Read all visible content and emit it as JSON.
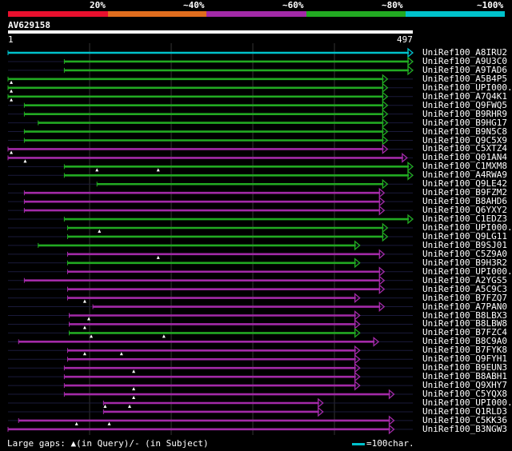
{
  "scale": {
    "labels": [
      "20%",
      "~40%",
      "~60%",
      "~80%",
      "~100%"
    ],
    "colors": [
      "#e8102e",
      "#e06d1e",
      "#a32aa8",
      "#22aa22",
      "#00c2cc"
    ]
  },
  "query": {
    "name": "AV629158",
    "start": "1",
    "end": "497",
    "length": 497
  },
  "hits": [
    {
      "name": "UniRef100_A8IRU2",
      "color": "#00c2cc",
      "segs": [
        [
          1,
          497
        ]
      ],
      "gaps": []
    },
    {
      "name": "UniRef100_A9U3C0",
      "color": "#22aa22",
      "segs": [
        [
          70,
          497
        ]
      ],
      "gaps": []
    },
    {
      "name": "UniRef100_A9TAD6",
      "color": "#22aa22",
      "segs": [
        [
          70,
          497
        ]
      ],
      "gaps": []
    },
    {
      "name": "UniRef100_A5B4P5",
      "color": "#22aa22",
      "segs": [
        [
          1,
          466
        ]
      ],
      "gaps": [
        5
      ]
    },
    {
      "name": "UniRef100_UPI000..",
      "color": "#22aa22",
      "segs": [
        [
          1,
          466
        ]
      ],
      "gaps": [
        5
      ]
    },
    {
      "name": "UniRef100_A7Q4K1",
      "color": "#22aa22",
      "segs": [
        [
          1,
          466
        ]
      ],
      "gaps": [
        5
      ]
    },
    {
      "name": "UniRef100_Q9FWQ5",
      "color": "#22aa22",
      "segs": [
        [
          21,
          466
        ]
      ],
      "gaps": []
    },
    {
      "name": "UniRef100_B9RHR9",
      "color": "#22aa22",
      "segs": [
        [
          21,
          466
        ]
      ],
      "gaps": []
    },
    {
      "name": "UniRef100_B9HG17",
      "color": "#22aa22",
      "segs": [
        [
          38,
          466
        ]
      ],
      "gaps": []
    },
    {
      "name": "UniRef100_B9N5C8",
      "color": "#22aa22",
      "segs": [
        [
          21,
          466
        ]
      ],
      "gaps": []
    },
    {
      "name": "UniRef100_Q9C5X9",
      "color": "#22aa22",
      "segs": [
        [
          21,
          466
        ]
      ],
      "gaps": []
    },
    {
      "name": "UniRef100_C5XTZ4",
      "color": "#a32aa8",
      "segs": [
        [
          1,
          466
        ]
      ],
      "gaps": [
        5
      ]
    },
    {
      "name": "UniRef100_Q01AN4",
      "color": "#a32aa8",
      "segs": [
        [
          1,
          490
        ]
      ],
      "gaps": [
        22
      ]
    },
    {
      "name": "UniRef100_C1MXM8",
      "color": "#22aa22",
      "segs": [
        [
          70,
          497
        ]
      ],
      "gaps": [
        110,
        185
      ]
    },
    {
      "name": "UniRef100_A4RWA9",
      "color": "#22aa22",
      "segs": [
        [
          70,
          497
        ]
      ],
      "gaps": []
    },
    {
      "name": "UniRef100_Q9LE42",
      "color": "#22aa22",
      "segs": [
        [
          110,
          466
        ]
      ],
      "gaps": []
    },
    {
      "name": "UniRef100_B9FZM2",
      "color": "#a32aa8",
      "segs": [
        [
          21,
          462
        ]
      ],
      "gaps": []
    },
    {
      "name": "UniRef100_B8AHD6",
      "color": "#a32aa8",
      "segs": [
        [
          21,
          462
        ]
      ],
      "gaps": []
    },
    {
      "name": "UniRef100_Q6YXY2",
      "color": "#a32aa8",
      "segs": [
        [
          21,
          462
        ]
      ],
      "gaps": []
    },
    {
      "name": "UniRef100_C1EDZ3",
      "color": "#22aa22",
      "segs": [
        [
          70,
          497
        ]
      ],
      "gaps": []
    },
    {
      "name": "UniRef100_UPI000..",
      "color": "#22aa22",
      "segs": [
        [
          74,
          466
        ]
      ],
      "gaps": [
        113
      ]
    },
    {
      "name": "UniRef100_Q9LG11",
      "color": "#22aa22",
      "segs": [
        [
          74,
          466
        ]
      ],
      "gaps": []
    },
    {
      "name": "UniRef100_B9SJ01",
      "color": "#22aa22",
      "segs": [
        [
          38,
          432
        ]
      ],
      "gaps": []
    },
    {
      "name": "UniRef100_C5Z9A0",
      "color": "#a32aa8",
      "segs": [
        [
          74,
          462
        ]
      ],
      "gaps": [
        185
      ]
    },
    {
      "name": "UniRef100_B9H3R2",
      "color": "#22aa22",
      "segs": [
        [
          74,
          432
        ]
      ],
      "gaps": []
    },
    {
      "name": "UniRef100_UPI000..",
      "color": "#a32aa8",
      "segs": [
        [
          74,
          462
        ]
      ],
      "gaps": []
    },
    {
      "name": "UniRef100_A2YGS5",
      "color": "#a32aa8",
      "segs": [
        [
          21,
          462
        ]
      ],
      "gaps": []
    },
    {
      "name": "UniRef100_A5C9C3",
      "color": "#a32aa8",
      "segs": [
        [
          74,
          462
        ]
      ],
      "gaps": []
    },
    {
      "name": "UniRef100_B7FZQ7",
      "color": "#a32aa8",
      "segs": [
        [
          74,
          432
        ]
      ],
      "gaps": [
        95
      ]
    },
    {
      "name": "UniRef100_A7PAN0",
      "color": "#a32aa8",
      "segs": [
        [
          105,
          462
        ]
      ],
      "gaps": []
    },
    {
      "name": "UniRef100_B8LBX3",
      "color": "#a32aa8",
      "segs": [
        [
          76,
          432
        ]
      ],
      "gaps": [
        100
      ]
    },
    {
      "name": "UniRef100_B8LBW8",
      "color": "#a32aa8",
      "segs": [
        [
          76,
          432
        ]
      ],
      "gaps": [
        95
      ]
    },
    {
      "name": "UniRef100_B7FZC4",
      "color": "#22aa22",
      "segs": [
        [
          76,
          432
        ]
      ],
      "gaps": [
        103,
        192
      ]
    },
    {
      "name": "UniRef100_B8C9A0",
      "color": "#a32aa8",
      "segs": [
        [
          14,
          455
        ]
      ],
      "gaps": []
    },
    {
      "name": "UniRef100_B7FYK8",
      "color": "#a32aa8",
      "segs": [
        [
          74,
          432
        ]
      ],
      "gaps": [
        95,
        140
      ]
    },
    {
      "name": "UniRef100_Q9FYH1",
      "color": "#a32aa8",
      "segs": [
        [
          74,
          432
        ]
      ],
      "gaps": []
    },
    {
      "name": "UniRef100_B9EUN3",
      "color": "#a32aa8",
      "segs": [
        [
          70,
          432
        ]
      ],
      "gaps": [
        155
      ]
    },
    {
      "name": "UniRef100_B8ABH1",
      "color": "#a32aa8",
      "segs": [
        [
          70,
          432
        ]
      ],
      "gaps": []
    },
    {
      "name": "UniRef100_Q9XHY7",
      "color": "#a32aa8",
      "segs": [
        [
          70,
          432
        ]
      ],
      "gaps": [
        155
      ]
    },
    {
      "name": "UniRef100_C5YQX8",
      "color": "#a32aa8",
      "segs": [
        [
          70,
          474
        ]
      ],
      "gaps": [
        155
      ]
    },
    {
      "name": "UniRef100_UPI000..",
      "color": "#a32aa8",
      "segs": [
        [
          118,
          387
        ]
      ],
      "gaps": [
        120,
        150
      ]
    },
    {
      "name": "UniRef100_Q1RLD3",
      "color": "#a32aa8",
      "segs": [
        [
          118,
          387
        ]
      ],
      "gaps": []
    },
    {
      "name": "UniRef100_C5KK36",
      "color": "#a32aa8",
      "segs": [
        [
          14,
          474
        ]
      ],
      "gaps": [
        85,
        125
      ]
    },
    {
      "name": "UniRef100_B3NGW3",
      "color": "#a32aa8",
      "segs": [
        [
          1,
          474
        ]
      ],
      "gaps": []
    }
  ],
  "legend": {
    "gaps_text": "Large gaps: ▲(in Query)/- (in Subject)",
    "scale_text": "=100char."
  }
}
